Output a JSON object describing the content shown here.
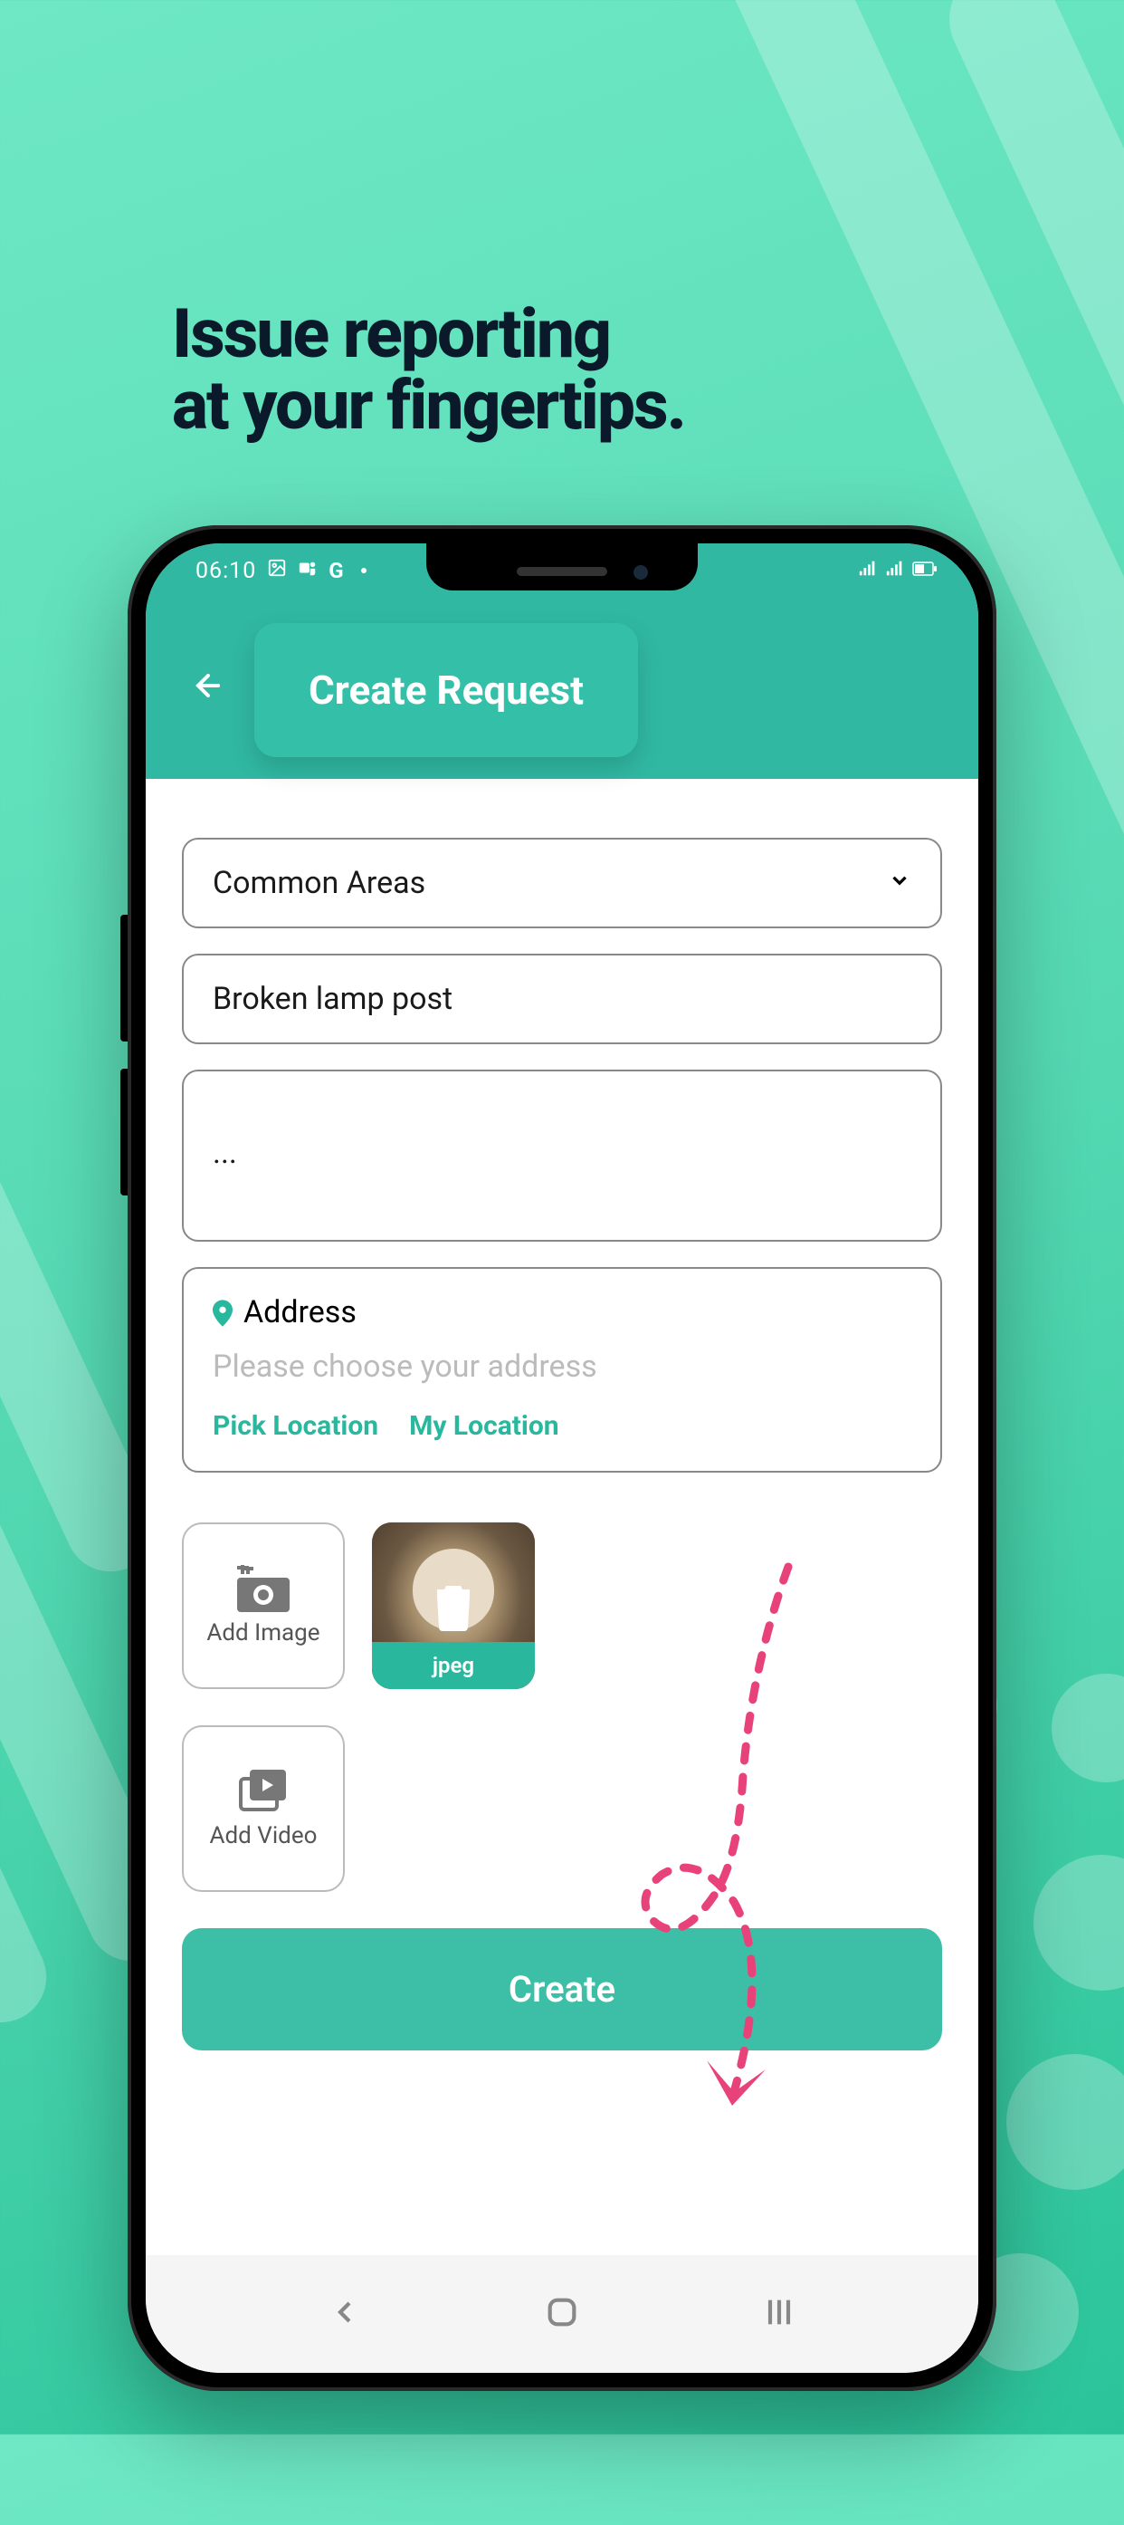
{
  "marketing": {
    "line1": "Issue reporting",
    "line2": "at your fingertips."
  },
  "status_bar": {
    "time": "06:10",
    "icons": [
      "gallery",
      "teams",
      "G",
      "dot"
    ],
    "right": [
      "signal",
      "signal2",
      "battery"
    ]
  },
  "header": {
    "title": "Create Request"
  },
  "form": {
    "category": {
      "selected": "Common Areas"
    },
    "title_input": {
      "value": "Broken lamp post"
    },
    "description": {
      "value": "..."
    },
    "address": {
      "label": "Address",
      "placeholder": "Please choose your address",
      "pick_location_label": "Pick Location",
      "my_location_label": "My Location"
    },
    "media": {
      "add_image_label": "Add Image",
      "add_video_label": "Add Video",
      "thumbnail_label": "jpeg"
    },
    "submit_label": "Create"
  },
  "colors": {
    "accent": "#29b89d",
    "annotation": "#e8427a"
  }
}
